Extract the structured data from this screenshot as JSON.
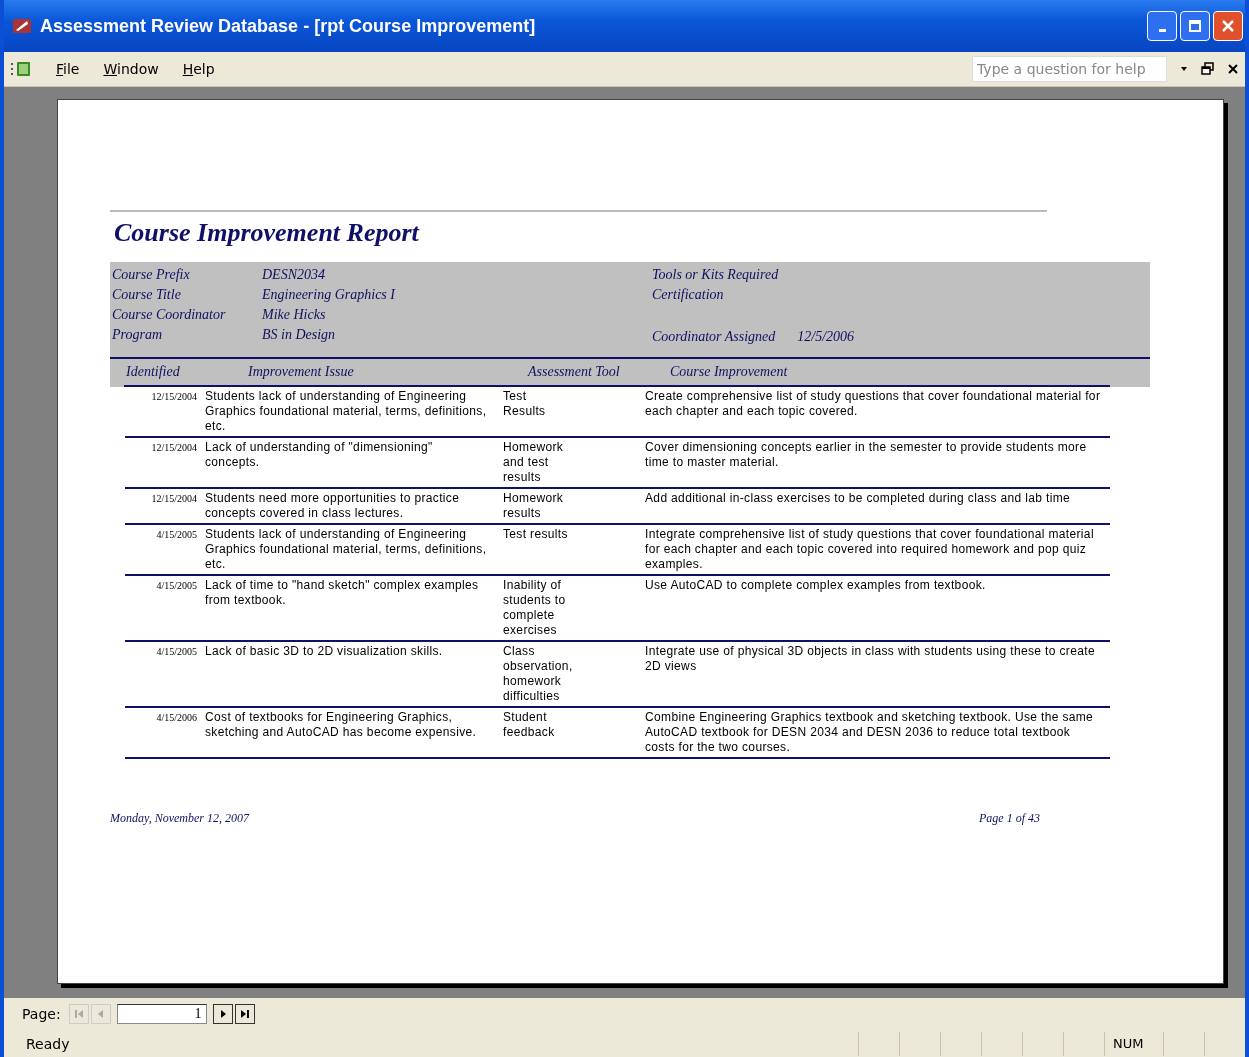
{
  "window": {
    "title": "Assessment Review Database - [rpt Course Improvement]"
  },
  "menu": {
    "items": [
      {
        "label": "File"
      },
      {
        "label": "Window"
      },
      {
        "label": "Help"
      }
    ],
    "help_search": {
      "placeholder": "Type a question for help"
    }
  },
  "report": {
    "title": "Course Improvement Report",
    "fields_left": [
      {
        "label": "Course Prefix",
        "value": "DESN2034"
      },
      {
        "label": "Course Title",
        "value": "Engineering Graphics I"
      },
      {
        "label": "Course Coordinator",
        "value": "Mike Hicks"
      },
      {
        "label": "Program",
        "value": "BS in Design"
      }
    ],
    "fields_right": [
      {
        "label": "Tools or Kits Required"
      },
      {
        "label": "Certification"
      },
      {
        "label": "Coordinator Assigned",
        "value": "12/5/2006"
      }
    ],
    "columns": [
      "Identified",
      "Improvement Issue",
      "Assessment Tool",
      "Course Improvement"
    ],
    "rows": [
      {
        "identified": "12/15/2004",
        "issue": "Students lack of understanding of Engineering Graphics foundational material, terms, definitions, etc.",
        "tool": "Test\nResults",
        "improvement": "Create comprehensive list of study questions that cover foundational material for each chapter and each topic covered."
      },
      {
        "identified": "12/15/2004",
        "issue": "Lack of understanding of \"dimensioning\" concepts.",
        "tool": "Homework\nand test\nresults",
        "improvement": "Cover dimensioning concepts earlier in the semester to provide students more time to master material."
      },
      {
        "identified": "12/15/2004",
        "issue": "Students need more opportunities to practice concepts covered in class lectures.",
        "tool": "Homework\nresults",
        "improvement": "Add additional in-class exercises to be completed during class and lab time"
      },
      {
        "identified": "4/15/2005",
        "issue": "Students lack of understanding of Engineering Graphics foundational material, terms, definitions, etc.",
        "tool": "Test results",
        "improvement": "Integrate comprehensive list of study questions that cover foundational material for each chapter and each topic covered into required homework and pop quiz examples."
      },
      {
        "identified": "4/15/2005",
        "issue": "Lack of time to \"hand sketch\" complex examples from textbook.",
        "tool": "Inability of\nstudents to\ncomplete\nexercises",
        "improvement": "Use AutoCAD to complete complex examples from textbook."
      },
      {
        "identified": "4/15/2005",
        "issue": "Lack of basic 3D to 2D visualization skills.",
        "tool": "Class\nobservation,\n homework\ndifficulties",
        "improvement": "Integrate use of physical 3D objects in class with students using these to create 2D views"
      },
      {
        "identified": "4/15/2006",
        "issue": "Cost of textbooks for Engineering Graphics, sketching and AutoCAD has become expensive.",
        "tool": "Student\nfeedback",
        "improvement": "Combine Engineering Graphics textbook and sketching textbook.  Use the same AutoCAD textbook for DESN 2034 and DESN 2036 to reduce total textbook costs for the two courses."
      }
    ],
    "footer": {
      "date": "Monday, November 12, 2007",
      "page": "Page 1 of 43"
    }
  },
  "navigator": {
    "label": "Page:",
    "buttons": [
      {
        "kind": "first",
        "disabled": true
      },
      {
        "kind": "prev",
        "disabled": true
      },
      {
        "kind": "next",
        "disabled": false
      },
      {
        "kind": "last",
        "disabled": false
      }
    ],
    "page": "1"
  },
  "status_bar": {
    "text": "Ready",
    "panels": [
      "NUM"
    ]
  }
}
